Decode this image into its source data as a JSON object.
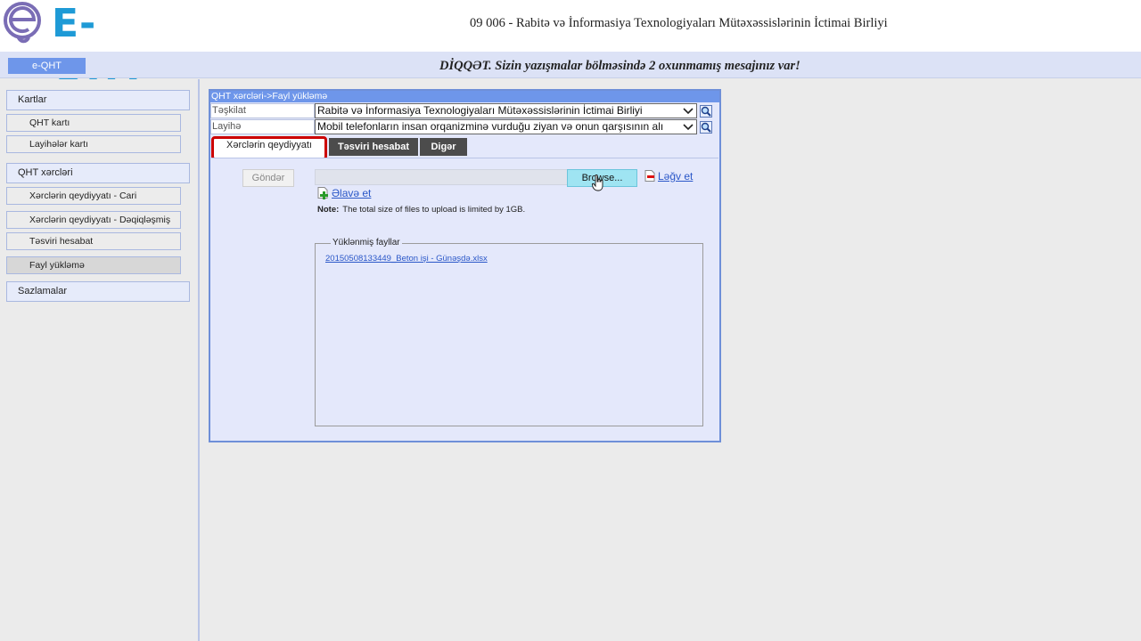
{
  "header": {
    "logo_text": "E-QHT",
    "org_title": "09 006 - Rabitə və İnformasiya Texnologiyaları Mütəxəssislərinin İctimai Birliyi"
  },
  "topbar": {
    "tab_label": "e-QHT",
    "notice": "DİQQƏT. Sizin yazışmalar bölməsində 2 oxunmamış mesajınız var!"
  },
  "sidebar": {
    "kartlar": "Kartlar",
    "qht_karti": "QHT kartı",
    "layiheler_karti": "Layihələr kartı",
    "qht_xercleri": "QHT xərcləri",
    "xerc_cari": "Xərclərin qeydiyyatı - Cari",
    "xerc_deqiq": "Xərclərin qeydiyyatı - Dəqiqləşmiş",
    "tesviri": "Təsviri hesabat",
    "fayl": "Fayl yükləmə",
    "sazlamalar": "Sazlamalar"
  },
  "panel": {
    "title": "QHT xərcləri->Fayl yükləmə",
    "teskilat_label": "Təşkilat",
    "teskilat_value": "Rabitə və İnformasiya Texnologiyaları Mütəxəssislərinin İctimai Birliyi",
    "layihe_label": "Layihə",
    "layihe_value": "Mobil telefonların insan orqanizminə vurduğu ziyan və onun qarşısının alı"
  },
  "tabs": {
    "tab1": "Xərclərin qeydiyyatı",
    "tab2": "Təsviri hesabat",
    "tab3": "Digər"
  },
  "upload": {
    "send": "Göndər",
    "browse": "Browse...",
    "cancel": "Ləğv et",
    "add": "Əlavə et",
    "note_label": "Note:",
    "note_text": "The total size of files to upload is limited by 1GB.",
    "uploaded_legend": "Yüklənmiş fayllar",
    "file_name": "20150508133449_Beton işi - Günəşdə.xlsx"
  },
  "colors": {
    "accent_blue": "#6e96ea",
    "logo_blue": "#1e9ad6",
    "active_tab_border": "#cc0000",
    "link": "#2a57c8"
  },
  "icons": {
    "lookup": "magnifier-icon",
    "cancel": "remove-file-icon",
    "add": "add-file-icon",
    "dropdown": "chevron-down-icon"
  }
}
